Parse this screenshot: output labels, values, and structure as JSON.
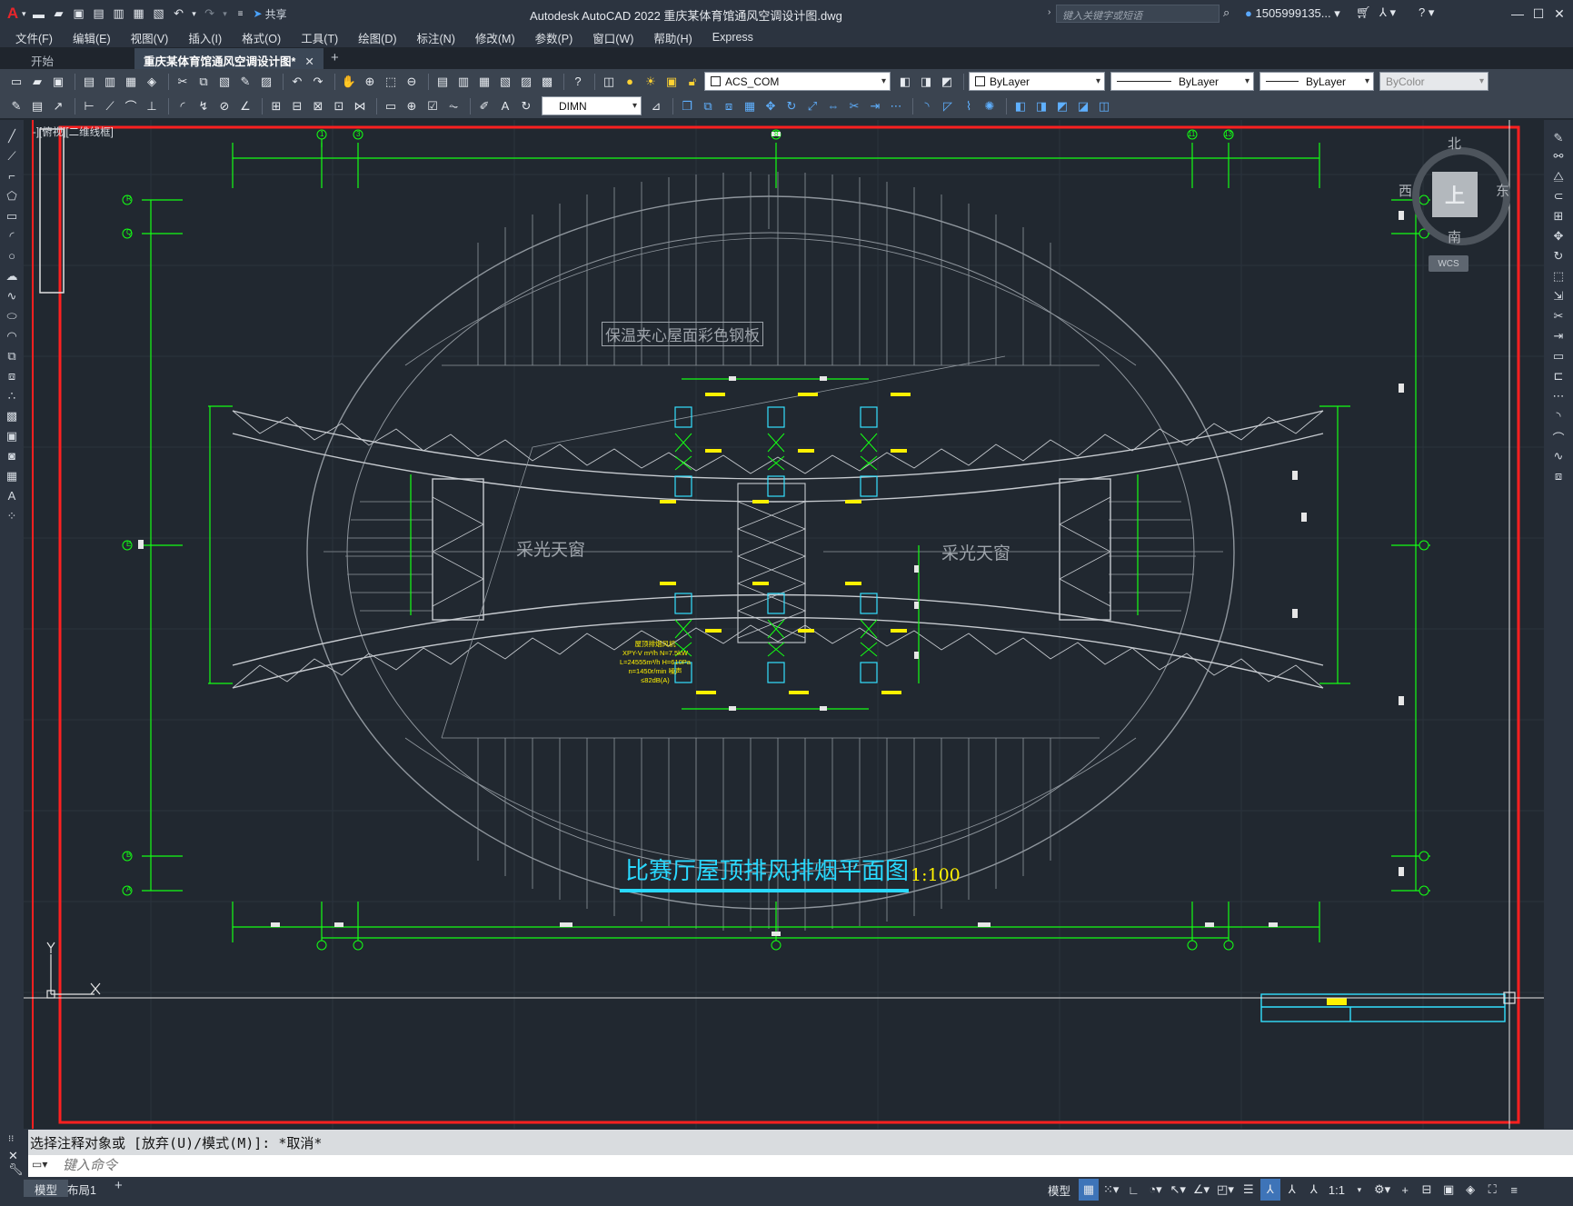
{
  "app": {
    "logo": "A",
    "title": "Autodesk AutoCAD 2022    重庆某体育馆通风空调设计图.dwg",
    "search_placeholder": "键入关键字或短语",
    "user": "1505999135...",
    "share_label": "共享"
  },
  "menu": [
    "文件(F)",
    "编辑(E)",
    "视图(V)",
    "插入(I)",
    "格式(O)",
    "工具(T)",
    "绘图(D)",
    "标注(N)",
    "修改(M)",
    "参数(P)",
    "窗口(W)",
    "帮助(H)",
    "Express"
  ],
  "tabs": {
    "start": "开始",
    "active": "重庆某体育馆通风空调设计图*"
  },
  "props": {
    "layer": "ACS_COM",
    "color": "ByLayer",
    "linetype": "ByLayer",
    "lineweight": "ByLayer",
    "plotstyle": "ByColor",
    "dimstyle": "DIMN"
  },
  "viewport": {
    "label": "-][俯视][二维线框]",
    "navcube_face": "上",
    "north": "北",
    "south": "南",
    "west": "西",
    "east": "东",
    "wcs": "WCS"
  },
  "drawing": {
    "title": "比赛厅屋顶排风排烟平面图",
    "scale": "1:100",
    "roof_label": "保温夹心屋面彩色钢板",
    "skylight_left": "采光天窗",
    "skylight_right": "采光天窗",
    "fan_note_1": "屋顶排烟风机",
    "fan_note_2": "XPY-V m³/h N=7.5kW",
    "fan_note_3": "L=24555m³/h H=610Pa",
    "fan_note_4": "n=1450r/min 噪声≤82dB(A)",
    "axis_left": [
      "R",
      "Q",
      "E",
      "B",
      "A"
    ],
    "axis_top": [
      "1",
      "3",
      "8",
      "11",
      "13"
    ]
  },
  "command": {
    "history": "选择注释对象或 [放弃(U)/模式(M)]: *取消*",
    "placeholder": "键入命令"
  },
  "layouts": [
    "模型",
    "布局1"
  ],
  "status": {
    "model": "模型",
    "scale": "1:1"
  }
}
